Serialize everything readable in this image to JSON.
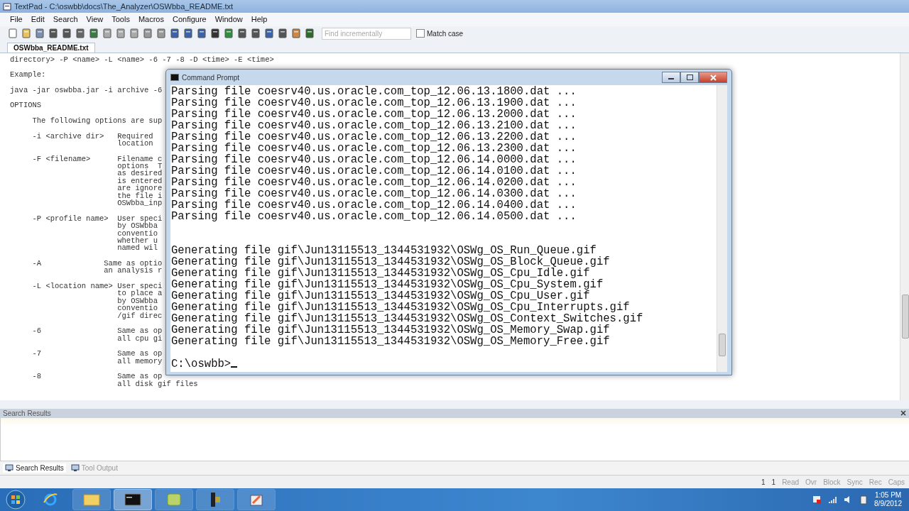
{
  "window": {
    "title": "TextPad - C:\\oswbb\\docs\\The_Analyzer\\OSWbba_README.txt"
  },
  "menu": [
    "File",
    "Edit",
    "Search",
    "View",
    "Tools",
    "Macros",
    "Configure",
    "Window",
    "Help"
  ],
  "toolbar": {
    "find": {
      "placeholder": "Find incrementally"
    },
    "match_case": {
      "label": "Match case",
      "checked": false
    }
  },
  "document_tabs": [
    {
      "label": "OSWbba_README.txt",
      "selected": true
    }
  ],
  "editor": {
    "blocks": [
      [
        "directory> -P <name> -L <name> -6 -7 -8 -D <time> -E <time>"
      ],
      [
        "Example:"
      ],
      [
        "java -jar oswbba.jar -i archive -6"
      ],
      [
        "OPTIONS"
      ],
      [
        "     The following options are sup"
      ],
      [
        "     -i <archive dir>   Required",
        "                        location"
      ],
      [
        "     -F <filename>      Filename c",
        "                        options  T",
        "                        as desired",
        "                        is entered",
        "                        are ignore",
        "                        the file i",
        "                        OSWbba_inp"
      ],
      [
        "     -P <profile name>  User speci",
        "                        by OSWbba",
        "                        conventio",
        "                        whether u",
        "                        named wil"
      ],
      [
        "     -A              Same as optio",
        "                     an analysis r"
      ],
      [
        "     -L <location name> User speci",
        "                        to place a",
        "                        by OSWbba",
        "                        conventio",
        "                        /gif direc"
      ],
      [
        "     -6                 Same as op",
        "                        all cpu gi"
      ],
      [
        "     -7                 Same as op",
        "                        all memory"
      ],
      [
        "     -8                 Same as op",
        "                        all disk gif files"
      ]
    ]
  },
  "console": {
    "title": "Command Prompt",
    "blocks": [
      [
        "Parsing file coesrv40.us.oracle.com_top_12.06.13.1800.dat ...",
        "Parsing file coesrv40.us.oracle.com_top_12.06.13.1900.dat ...",
        "Parsing file coesrv40.us.oracle.com_top_12.06.13.2000.dat ...",
        "Parsing file coesrv40.us.oracle.com_top_12.06.13.2100.dat ...",
        "Parsing file coesrv40.us.oracle.com_top_12.06.13.2200.dat ...",
        "Parsing file coesrv40.us.oracle.com_top_12.06.13.2300.dat ...",
        "Parsing file coesrv40.us.oracle.com_top_12.06.14.0000.dat ...",
        "Parsing file coesrv40.us.oracle.com_top_12.06.14.0100.dat ...",
        "Parsing file coesrv40.us.oracle.com_top_12.06.14.0200.dat ...",
        "Parsing file coesrv40.us.oracle.com_top_12.06.14.0300.dat ...",
        "Parsing file coesrv40.us.oracle.com_top_12.06.14.0400.dat ...",
        "Parsing file coesrv40.us.oracle.com_top_12.06.14.0500.dat ..."
      ],
      [
        "Generating file gif\\Jun13115513_1344531932\\OSWg_OS_Run_Queue.gif",
        "Generating file gif\\Jun13115513_1344531932\\OSWg_OS_Block_Queue.gif",
        "Generating file gif\\Jun13115513_1344531932\\OSWg_OS_Cpu_Idle.gif",
        "Generating file gif\\Jun13115513_1344531932\\OSWg_OS_Cpu_System.gif",
        "Generating file gif\\Jun13115513_1344531932\\OSWg_OS_Cpu_User.gif",
        "Generating file gif\\Jun13115513_1344531932\\OSWg_OS_Cpu_Interrupts.gif",
        "Generating file gif\\Jun13115513_1344531932\\OSWg_OS_Context_Switches.gif",
        "Generating file gif\\Jun13115513_1344531932\\OSWg_OS_Memory_Swap.gif",
        "Generating file gif\\Jun13115513_1344531932\\OSWg_OS_Memory_Free.gif"
      ]
    ],
    "prompt": "C:\\oswbb>"
  },
  "search_results": {
    "title": "Search Results"
  },
  "bottom_tabs": [
    {
      "label": "Search Results",
      "selected": true
    },
    {
      "label": "Tool Output",
      "selected": false
    }
  ],
  "status_bar": [
    "1",
    "1",
    "Read",
    "Ovr",
    "Block",
    "Sync",
    "Rec",
    "Caps"
  ],
  "clock": {
    "time": "1:05 PM",
    "date": "8/9/2012"
  }
}
